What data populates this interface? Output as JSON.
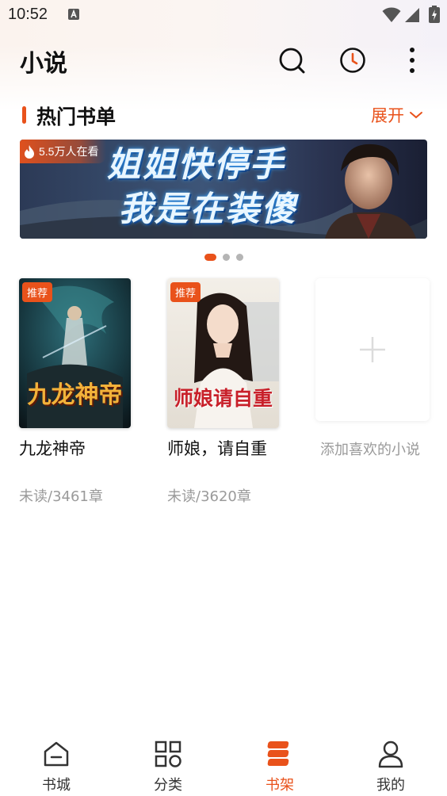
{
  "status_bar": {
    "time": "10:52"
  },
  "header": {
    "title": "小说"
  },
  "section": {
    "title": "热门书单",
    "expand_label": "展开"
  },
  "banner": {
    "badge": "5.5万人在看",
    "title_line1": "姐姐快停手",
    "title_line2": "我是在装傻"
  },
  "carousel": {
    "count": 3,
    "active_index": 0
  },
  "books": [
    {
      "name": "九龙神帝",
      "progress": "未读/3461章",
      "badge": "推荐",
      "cover_title": "九龙神帝"
    },
    {
      "name": "师娘，请自重",
      "progress": "未读/3620章",
      "badge": "推荐",
      "cover_title": "师娘请自重"
    }
  ],
  "add_card": {
    "label": "添加喜欢的小说"
  },
  "bottom_nav": [
    {
      "label": "书城",
      "icon": "home-icon"
    },
    {
      "label": "分类",
      "icon": "category-grid-icon"
    },
    {
      "label": "书架",
      "icon": "bookshelf-icon"
    },
    {
      "label": "我的",
      "icon": "profile-icon"
    }
  ],
  "active_tab": "书架",
  "colors": {
    "accent": "#e9521b",
    "muted_text": "#9a9a9a",
    "title_text": "#111111"
  }
}
